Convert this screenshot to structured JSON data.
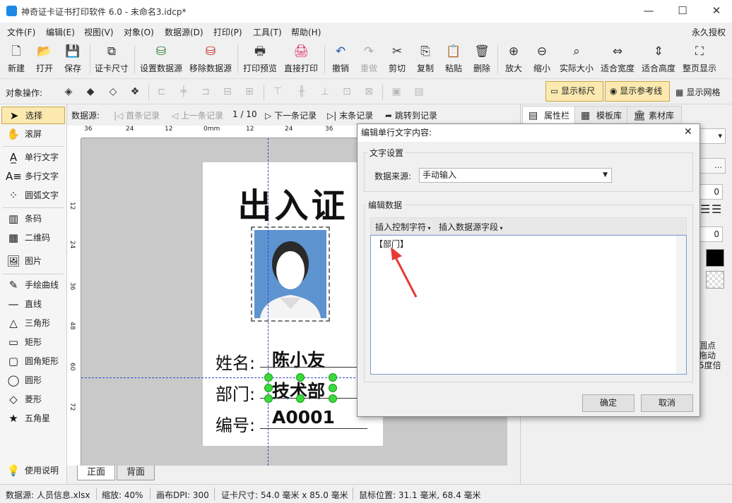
{
  "window": {
    "title": "神奇证卡证书打印软件 6.0 - 未命名3.idcp*",
    "minimize": "—",
    "maximize": "☐",
    "close": "✕"
  },
  "menu": {
    "items": [
      "文件(F)",
      "编辑(E)",
      "视图(V)",
      "对象(O)",
      "数据源(D)",
      "打印(P)",
      "工具(T)",
      "帮助(H)"
    ],
    "license": "永久授权"
  },
  "toolbar": {
    "new": "新建",
    "open": "打开",
    "save": "保存",
    "card_size": "证卡尺寸",
    "set_datasource": "设置数据源",
    "remove_datasource": "移除数据源",
    "print_preview": "打印预览",
    "direct_print": "直接打印",
    "undo": "撤销",
    "redo": "重做",
    "cut": "剪切",
    "copy": "复制",
    "paste": "粘贴",
    "delete": "删除",
    "zoom_in": "放大",
    "zoom_out": "缩小",
    "actual_size": "实际大小",
    "fit_width": "适合宽度",
    "fit_height": "适合高度",
    "full_page": "整页显示"
  },
  "objbar": {
    "label": "对象操作:",
    "show_ruler": "显示标尺",
    "show_guides": "显示参考线",
    "show_grid": "显示网格"
  },
  "tools": {
    "select": "选择",
    "pan": "滚屏",
    "single_text": "单行文字",
    "multi_text": "多行文字",
    "arc_text": "圆弧文字",
    "barcode": "条码",
    "qrcode": "二维码",
    "image": "图片",
    "freehand": "手绘曲线",
    "line": "直线",
    "triangle": "三角形",
    "rect": "矩形",
    "round_rect": "圆角矩形",
    "circle": "圆形",
    "diamond": "菱形",
    "star": "五角星",
    "help": "使用说明"
  },
  "recnav": {
    "label": "数据源:",
    "first": "首条记录",
    "prev": "上一条记录",
    "position": "1 / 10",
    "next": "下一条记录",
    "last": "末条记录",
    "jump": "跳转到记录"
  },
  "ruler": {
    "h_ticks": [
      "36",
      "24",
      "12",
      "0mm",
      "12",
      "24",
      "36"
    ],
    "v_ticks": [
      "12",
      "24",
      "36",
      "48",
      "60",
      "72"
    ]
  },
  "card": {
    "title": "出入证",
    "fields": [
      {
        "label": "姓名:",
        "value": "陈小友"
      },
      {
        "label": "部门:",
        "value": "技术部"
      },
      {
        "label": "编号:",
        "value": "A0001"
      }
    ]
  },
  "page_tabs": {
    "front": "正面",
    "back": "背面"
  },
  "right_tabs": {
    "properties": "属性栏",
    "templates": "模板库",
    "materials": "素材库"
  },
  "right_panel": {
    "val1": "0",
    "val2": "0",
    "hint_lines": [
      "圆点",
      "拖动",
      "5度倍"
    ]
  },
  "dialog": {
    "title": "编辑单行文字内容:",
    "text_settings": "文字设置",
    "source_label": "数据来源:",
    "source_value": "手动输入",
    "edit_data": "编辑数据",
    "insert_control": "插入控制字符",
    "insert_field": "插入数据源字段",
    "text_content": "【部门】",
    "ok": "确定",
    "cancel": "取消"
  },
  "status": {
    "datasource": "数据源: 人员信息.xlsx",
    "zoom": "缩放: 40%",
    "dpi": "画布DPI: 300",
    "card_size": "证卡尺寸: 54.0 毫米 x 85.0 毫米",
    "mouse": "鼠标位置: 31.1 毫米, 68.4 毫米"
  },
  "colors": {
    "accent": "#fbe9b0",
    "accent_border": "#c9a74a",
    "photo_bg": "#5d94d0",
    "handle": "#3cd93c",
    "arrow": "#e53935"
  }
}
